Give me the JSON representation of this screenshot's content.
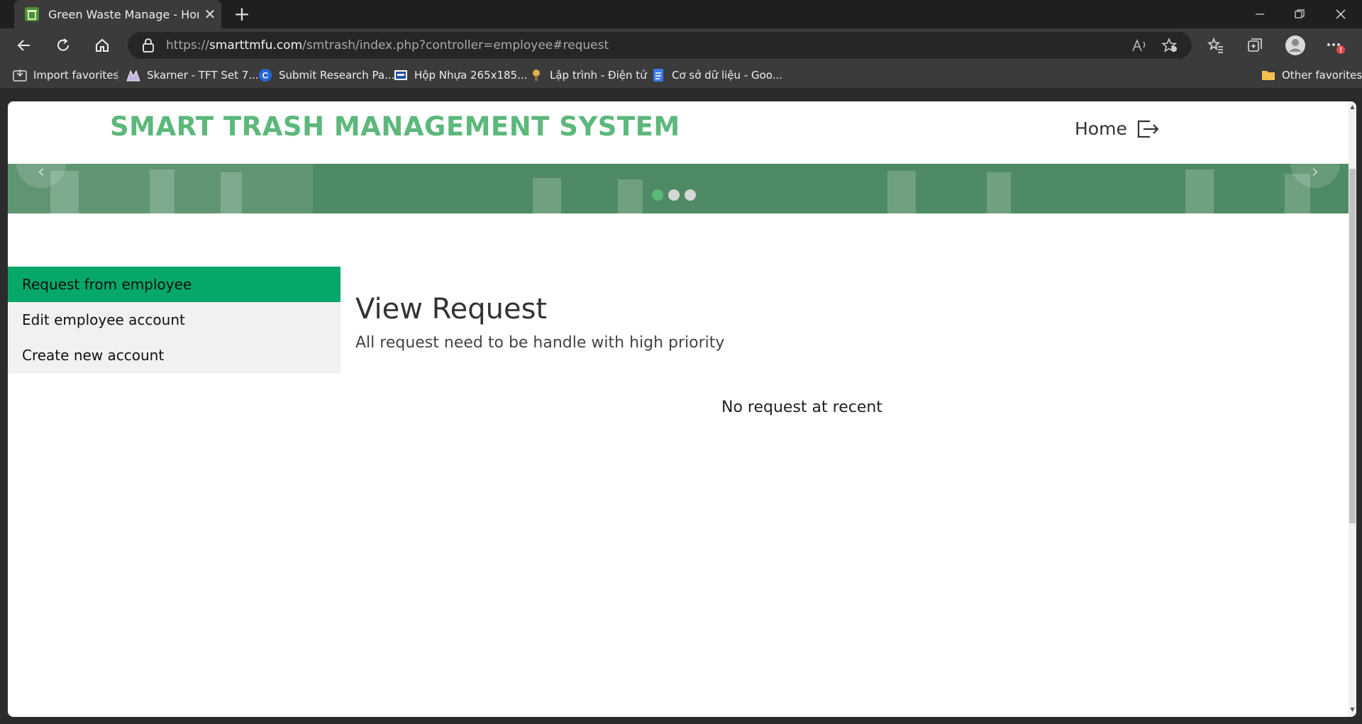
{
  "browser": {
    "tab_title": "Green Waste Manage - Home",
    "url_prefix": "https://",
    "url_host": "smarttmfu.com",
    "url_path": "/smtrash/index.php?controller=employee#request",
    "favorites": [
      {
        "label": "Import favorites",
        "icon": "import-icon"
      },
      {
        "label": "Skarner - TFT Set 7...",
        "icon": "skarner-favicon"
      },
      {
        "label": "Submit Research Pa...",
        "icon": "submit-favicon"
      },
      {
        "label": "Hộp Nhựa 265x185...",
        "icon": "shop-favicon"
      },
      {
        "label": "Lập trình - Điện tử",
        "icon": "electronics-favicon"
      },
      {
        "label": "Cơ sở dữ liệu - Goo...",
        "icon": "docs-favicon"
      }
    ],
    "other_favorites": "Other favorites"
  },
  "site": {
    "title": "SMART TRASH MANAGEMENT SYSTEM",
    "nav_home": "Home",
    "brand_color": "#5cb87b",
    "active_color": "#06a86a"
  },
  "carousel": {
    "slide_count": 3,
    "active_index": 0
  },
  "sidebar": {
    "items": [
      {
        "label": "Request from employee",
        "active": true
      },
      {
        "label": "Edit employee account",
        "active": false
      },
      {
        "label": "Create new account",
        "active": false
      }
    ]
  },
  "main": {
    "title": "View Request",
    "subtitle": "All request need to be handle with high priority",
    "empty_message": "No request at recent"
  }
}
